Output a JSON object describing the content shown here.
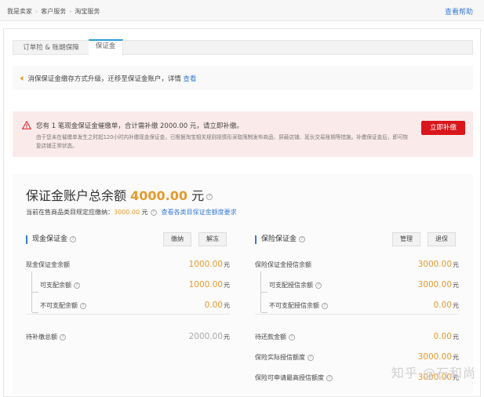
{
  "header": {
    "breadcrumb": [
      "我是卖家",
      "客户服务",
      "淘宝服务"
    ],
    "help": "查看帮助"
  },
  "tabs": [
    {
      "label": "订单险 & 账期保障"
    },
    {
      "label": "保证金",
      "active": true
    }
  ],
  "notice": {
    "icon": "speaker-icon",
    "text": "消保保证金缴存方式升级，迁移至保证金账户，详情",
    "link": "查看"
  },
  "alert": {
    "icon": "warning-triangle-icon",
    "title": "您有 1 笔现金保证金催缴单，合计需补缴 2000.00 元，请立即补缴。",
    "desc": "由于您未在催缴单发生之时起120小时内补缴现金保证金，已根据淘宝相关规则视情形采取限制发布商品、屏蔽店铺、延长交易账期等措施。补缴保证金后，即可恢复店铺正常状态。",
    "button": "立即补缴"
  },
  "balance": {
    "title": "保证金账户总余额",
    "amount": "4000.00",
    "unit": "元",
    "sub_label": "当前在售商品类目规定应缴纳：",
    "sub_amount": "3000.00",
    "sub_unit": "元",
    "sub_link": "查看各类目保证金额度要求"
  },
  "cash": {
    "title": "现金保证金",
    "buttons": [
      "缴纳",
      "解冻"
    ],
    "rows": [
      {
        "label": "现金保证金余额",
        "value": "1000.00",
        "unit": "元"
      },
      {
        "label": "可支配余额",
        "value": "1000.00",
        "unit": "元"
      },
      {
        "label": "不可支配余额",
        "value": "0.00",
        "unit": "元"
      },
      {
        "label": "待补缴总额",
        "value": "2000.00",
        "unit": "元"
      }
    ]
  },
  "insurance": {
    "title": "保险保证金",
    "buttons": [
      "管理",
      "退保"
    ],
    "rows": [
      {
        "label": "保险保证金授信余额",
        "value": "3000.00",
        "unit": "元"
      },
      {
        "label": "可支配授信余额",
        "value": "3000.00",
        "unit": "元"
      },
      {
        "label": "不可支配授信余额",
        "value": "0.00",
        "unit": "元"
      },
      {
        "label": "待还款金额",
        "value": "0.00",
        "unit": "元"
      },
      {
        "label": "保险实际授信额度",
        "value": "3000.00",
        "unit": "元"
      },
      {
        "label": "保险可申请最高授信额度",
        "value": "3000.00",
        "unit": "元"
      }
    ]
  },
  "watermark": "知乎 @石和尚",
  "colors": {
    "accent": "#3a7bd5",
    "amount": "#e59b2c",
    "alert_bg": "#fbeaea",
    "danger": "#d9161c"
  }
}
